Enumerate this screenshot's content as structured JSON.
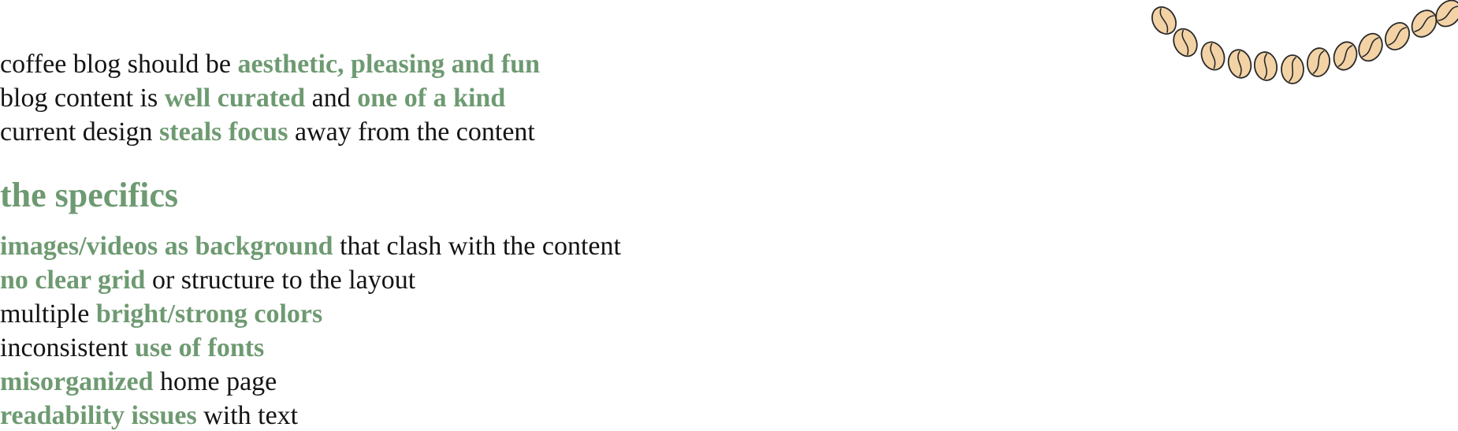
{
  "intro": [
    {
      "segments": [
        {
          "text": "coffee blog should be ",
          "hl": false
        },
        {
          "text": "aesthetic, pleasing and fun",
          "hl": true
        }
      ]
    },
    {
      "segments": [
        {
          "text": "blog content is ",
          "hl": false
        },
        {
          "text": "well curated",
          "hl": true
        },
        {
          "text": " and ",
          "hl": false
        },
        {
          "text": "one of a kind",
          "hl": true
        }
      ]
    },
    {
      "segments": [
        {
          "text": "current design ",
          "hl": false
        },
        {
          "text": "steals focus",
          "hl": true
        },
        {
          "text": " away from the content",
          "hl": false
        }
      ]
    }
  ],
  "heading": "the specifics",
  "specifics": [
    {
      "segments": [
        {
          "text": "images/videos as background",
          "hl": true
        },
        {
          "text": " that clash with the content",
          "hl": false
        }
      ]
    },
    {
      "segments": [
        {
          "text": "no clear grid",
          "hl": true
        },
        {
          "text": " or structure to the layout",
          "hl": false
        }
      ]
    },
    {
      "segments": [
        {
          "text": "multiple ",
          "hl": false
        },
        {
          "text": "bright/strong colors",
          "hl": true
        }
      ]
    },
    {
      "segments": [
        {
          "text": "inconsistent ",
          "hl": false
        },
        {
          "text": "use of fonts",
          "hl": true
        }
      ]
    },
    {
      "segments": [
        {
          "text": "misorganized",
          "hl": true
        },
        {
          "text": " home page",
          "hl": false
        }
      ]
    },
    {
      "segments": [
        {
          "text": "readability issues",
          "hl": true
        },
        {
          "text": " with text",
          "hl": false
        }
      ]
    }
  ],
  "decoration": {
    "icon": "coffee-bean-garland-icon",
    "bean_count": 12,
    "bean_fill": "#f3d3a6",
    "bean_stroke": "#2a2a2a"
  },
  "colors": {
    "accent": "#6e9a72",
    "text": "#141414",
    "background": "#ffffff"
  }
}
